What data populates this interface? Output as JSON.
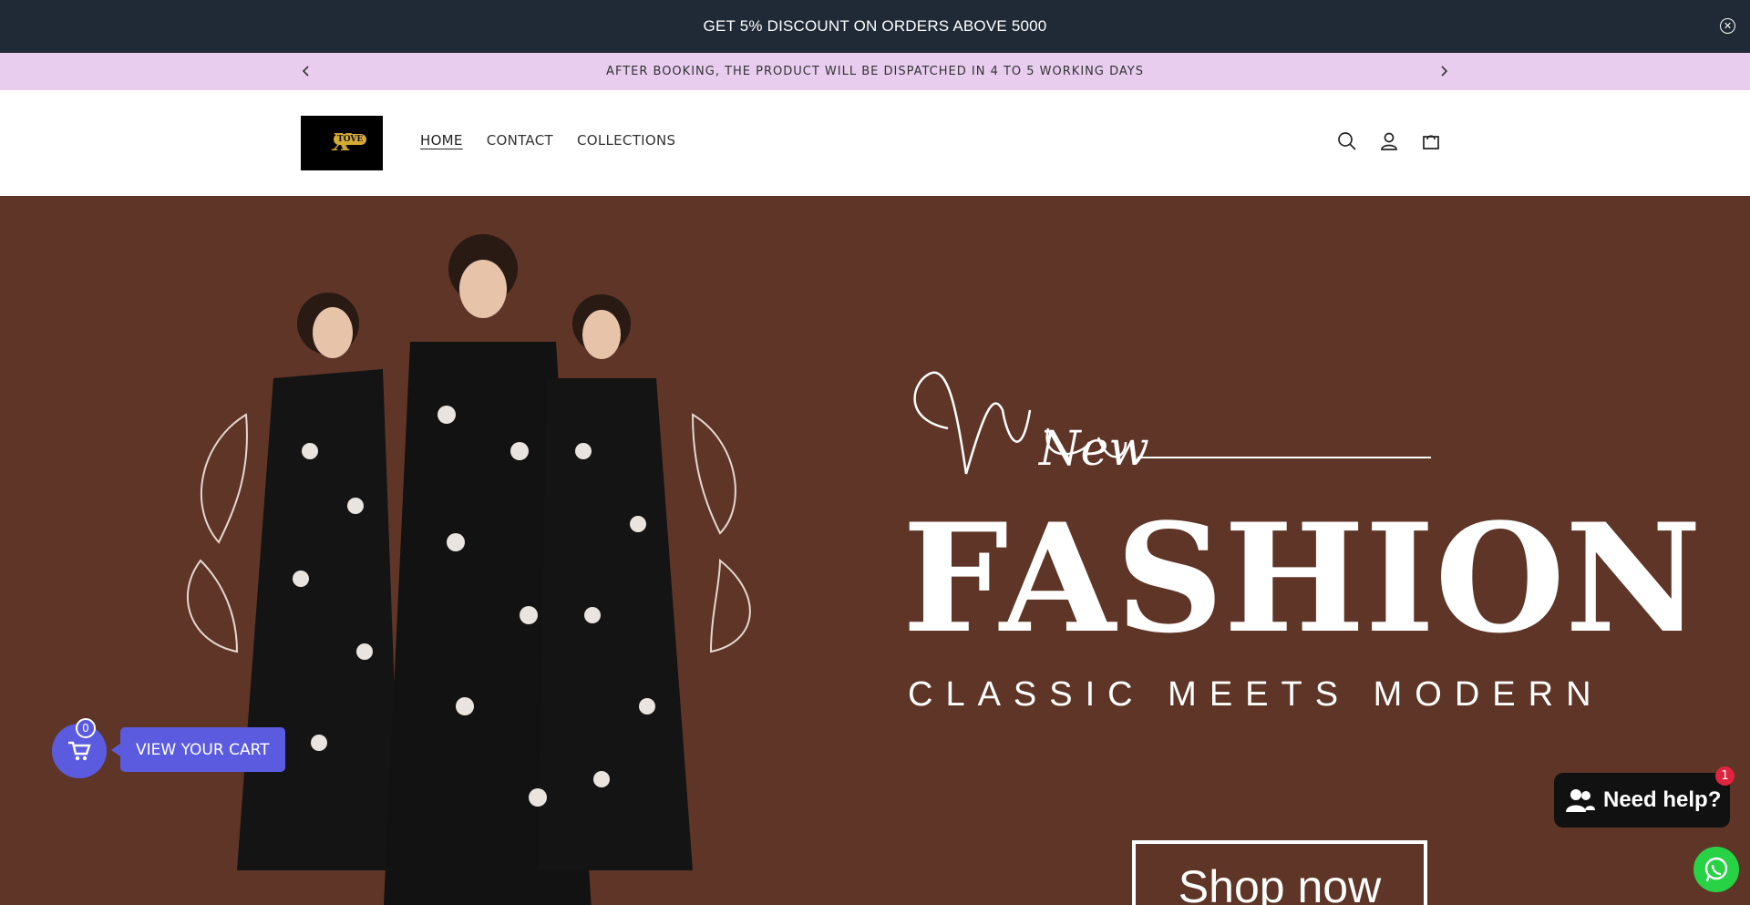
{
  "topbar": {
    "text": "GET 5% DISCOUNT ON ORDERS ABOVE 5000"
  },
  "announcement": {
    "text": "AFTER BOOKING, THE PRODUCT WILL BE DISPATCHED IN 4 TO 5 WORKING DAYS"
  },
  "logo": {
    "text": "TOVE",
    "icons": [
      "x-logo-mark"
    ]
  },
  "nav": {
    "items": [
      {
        "label": "HOME",
        "active": true
      },
      {
        "label": "CONTACT",
        "active": false
      },
      {
        "label": "COLLECTIONS",
        "active": false
      }
    ]
  },
  "header_icons": [
    "search-icon",
    "account-icon",
    "cart-icon"
  ],
  "hero": {
    "script_word": "New",
    "headline": "FASHION",
    "tagline": "CLASSIC MEETS MODERN",
    "button": "Shop now",
    "background": "#5e3526"
  },
  "cart_widget": {
    "count": "0",
    "label": "VIEW YOUR CART",
    "color": "#5b5be0"
  },
  "help_widget": {
    "label": "Need help?",
    "badge": "1"
  }
}
